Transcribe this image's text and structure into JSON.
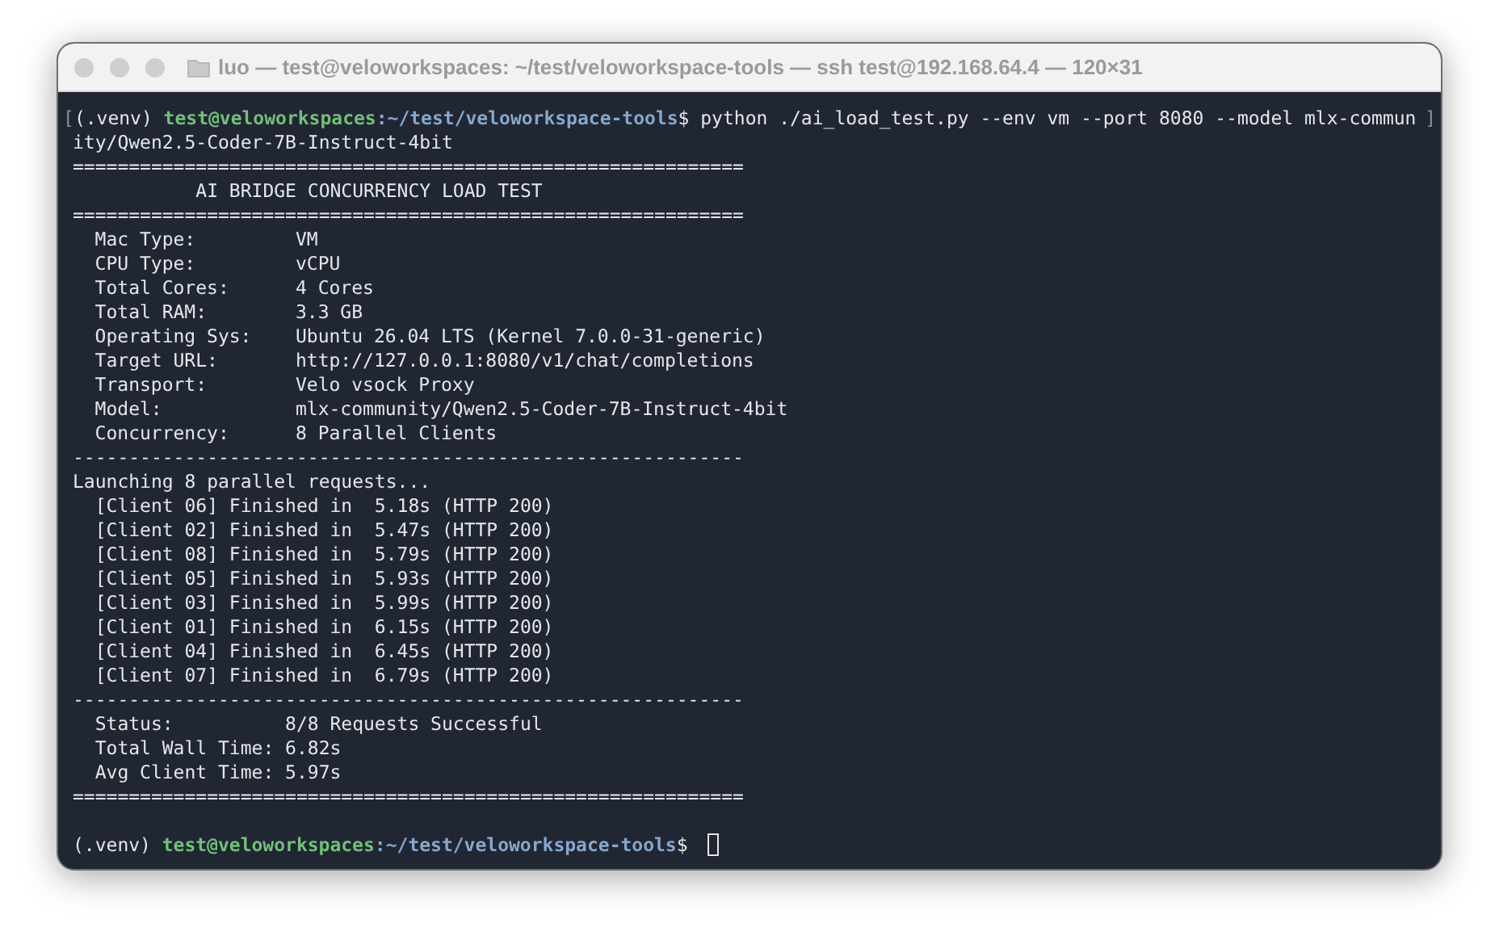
{
  "window": {
    "title": "luo — test@veloworkspaces: ~/test/veloworkspace-tools — ssh test@192.168.64.4 — 120×31"
  },
  "terminal": {
    "lines": [
      {
        "kind": "prompt",
        "mark_left": "[",
        "env": "(.venv)",
        "user_host": "test@veloworkspaces",
        "path": ":~/test/veloworkspace-tools",
        "symbol": "$",
        "command": "python ./ai_load_test.py --env vm --port 8080 --model mlx-commun",
        "mark_right": "]",
        "cursor": false
      },
      {
        "kind": "text",
        "text": "ity/Qwen2.5-Coder-7B-Instruct-4bit"
      },
      {
        "kind": "text",
        "text": "============================================================"
      },
      {
        "kind": "text",
        "text": "           AI BRIDGE CONCURRENCY LOAD TEST"
      },
      {
        "kind": "text",
        "text": "============================================================"
      },
      {
        "kind": "field",
        "label": "Mac Type:",
        "value": "VM"
      },
      {
        "kind": "field",
        "label": "CPU Type:",
        "value": "vCPU"
      },
      {
        "kind": "field",
        "label": "Total Cores:",
        "value": "4 Cores"
      },
      {
        "kind": "field",
        "label": "Total RAM:",
        "value": "3.3 GB"
      },
      {
        "kind": "field",
        "label": "Operating Sys:",
        "value": "Ubuntu 26.04 LTS (Kernel 7.0.0-31-generic)"
      },
      {
        "kind": "field",
        "label": "Target URL:",
        "value": "http://127.0.0.1:8080/v1/chat/completions"
      },
      {
        "kind": "field",
        "label": "Transport:",
        "value": "Velo vsock Proxy"
      },
      {
        "kind": "field",
        "label": "Model:",
        "value": "mlx-community/Qwen2.5-Coder-7B-Instruct-4bit"
      },
      {
        "kind": "field",
        "label": "Concurrency:",
        "value": "8 Parallel Clients"
      },
      {
        "kind": "text",
        "text": "------------------------------------------------------------"
      },
      {
        "kind": "text",
        "text": "Launching 8 parallel requests..."
      },
      {
        "kind": "text",
        "text": "  [Client 06] Finished in  5.18s (HTTP 200)"
      },
      {
        "kind": "text",
        "text": "  [Client 02] Finished in  5.47s (HTTP 200)"
      },
      {
        "kind": "text",
        "text": "  [Client 08] Finished in  5.79s (HTTP 200)"
      },
      {
        "kind": "text",
        "text": "  [Client 05] Finished in  5.93s (HTTP 200)"
      },
      {
        "kind": "text",
        "text": "  [Client 03] Finished in  5.99s (HTTP 200)"
      },
      {
        "kind": "text",
        "text": "  [Client 01] Finished in  6.15s (HTTP 200)"
      },
      {
        "kind": "text",
        "text": "  [Client 04] Finished in  6.45s (HTTP 200)"
      },
      {
        "kind": "text",
        "text": "  [Client 07] Finished in  6.79s (HTTP 200)"
      },
      {
        "kind": "text",
        "text": "------------------------------------------------------------"
      },
      {
        "kind": "text",
        "text": "  Status:          8/8 Requests Successful"
      },
      {
        "kind": "text",
        "text": "  Total Wall Time: 6.82s"
      },
      {
        "kind": "text",
        "text": "  Avg Client Time: 5.97s"
      },
      {
        "kind": "text",
        "text": "============================================================"
      },
      {
        "kind": "blank"
      },
      {
        "kind": "prompt",
        "env": "(.venv)",
        "user_host": "test@veloworkspaces",
        "path": ":~/test/veloworkspace-tools",
        "symbol": "$",
        "cursor": true
      }
    ]
  }
}
